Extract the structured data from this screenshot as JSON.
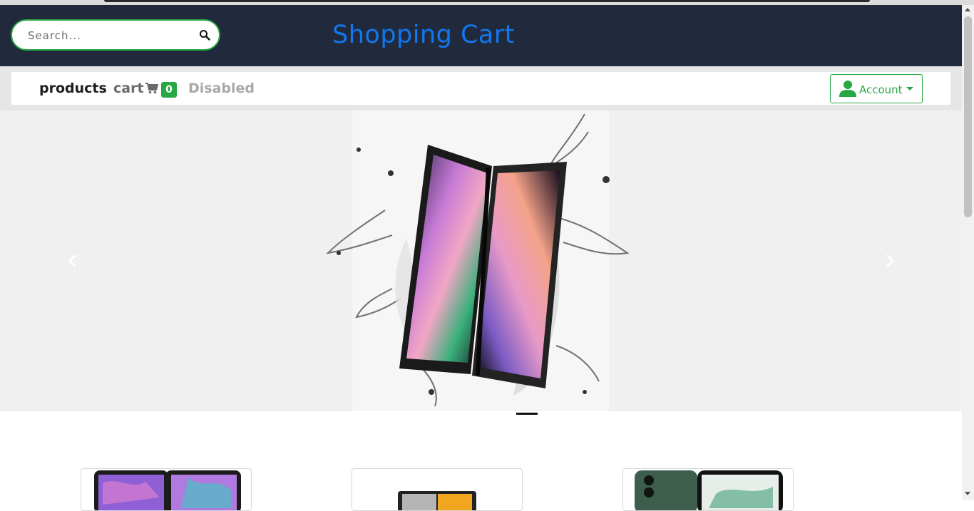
{
  "search": {
    "placeholder": "Search...",
    "icon": "search-icon"
  },
  "header": {
    "brand": "Shopping Cart",
    "brand_color": "#1177ee",
    "background": "#212a3c"
  },
  "nav": {
    "products_label": "products",
    "cart_label": "cart",
    "cart_icon": "shopping-cart-icon",
    "cart_count": "0",
    "disabled_label": "Disabled",
    "account_label": "Account",
    "account_icon": "user-icon"
  },
  "carousel": {
    "prev_icon": "chevron-left-icon",
    "next_icon": "chevron-right-icon",
    "slides_visible": 1,
    "active_indicator": 1
  },
  "products": [
    {
      "image": "foldable-phone-purple"
    },
    {
      "image": "phone-orange-screen"
    },
    {
      "image": "phone-green-back"
    }
  ],
  "colors": {
    "accent": "#28a745",
    "header_bg": "#212a3c",
    "brand": "#1177ee"
  }
}
